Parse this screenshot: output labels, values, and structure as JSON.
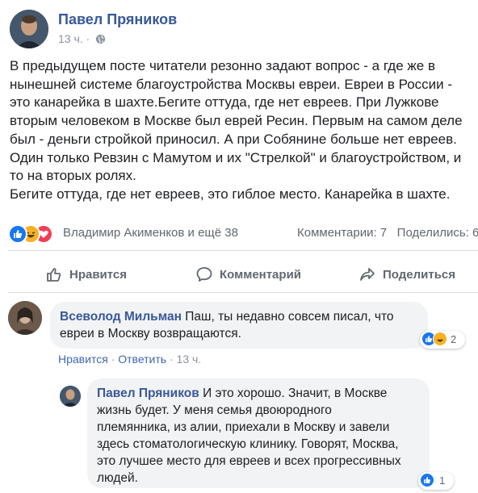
{
  "post": {
    "author_name": "Павел Пряников",
    "time": "13 ч. ·",
    "privacy_icon": "globe-icon",
    "body_lines": [
      "В предыдущем посте читатели резонно задают вопрос - а где же в",
      "нынешней системе благоустройства Москвы евреи. Евреи в России -",
      "это канарейка в шахте.Бегите оттуда, где нет евреев. При Лужкове",
      "вторым человеком в Москве был еврей Ресин. Первым на самом деле",
      "был - деньги стройкой приносил. А при Собянине больше нет евреев.",
      "Один только Ревзин с Мамутом и их \"Стрелкой\" и благоустройством, и",
      "то на вторых ролях.",
      "Бегите оттуда, где нет евреев, это гиблое место. Канарейка в шахте."
    ]
  },
  "reactions": {
    "icons": [
      "like-icon",
      "haha-icon",
      "love-icon"
    ],
    "names": "Владимир Акименков и ещё 38",
    "comments": "Комментарии: 7",
    "shares": "Поделились: 6"
  },
  "actions": {
    "like": "Нравится",
    "comment": "Комментарий",
    "share": "Поделиться"
  },
  "comments": [
    {
      "author": "Всеволод Мильман",
      "lines": [
        "Паш, ты недавно совсем писал, что",
        "евреи в Москву возвращаются."
      ],
      "like_link": "Нравится",
      "reply_link": "Ответить",
      "sep": "·",
      "time": "13 ч.",
      "reaction_count": "2"
    },
    {
      "author": "Павел Пряников",
      "lines": [
        "И это хорошо. Значит, в Москве",
        "жизнь будет. У меня семья двоюродного",
        "племянника, из алии, приехали в Москву и завели",
        "здесь стоматологическую клинику. Говорят, Москва,",
        "это лучшее место для евреев и всех прогрессивных",
        "людей."
      ],
      "reaction_count": "1"
    }
  ],
  "colors": {
    "link_blue": "#385898",
    "like_blue": "#1877f2",
    "haha_yellow": "#f7b125",
    "love_red": "#f33e58",
    "muted_gray": "#606770"
  }
}
